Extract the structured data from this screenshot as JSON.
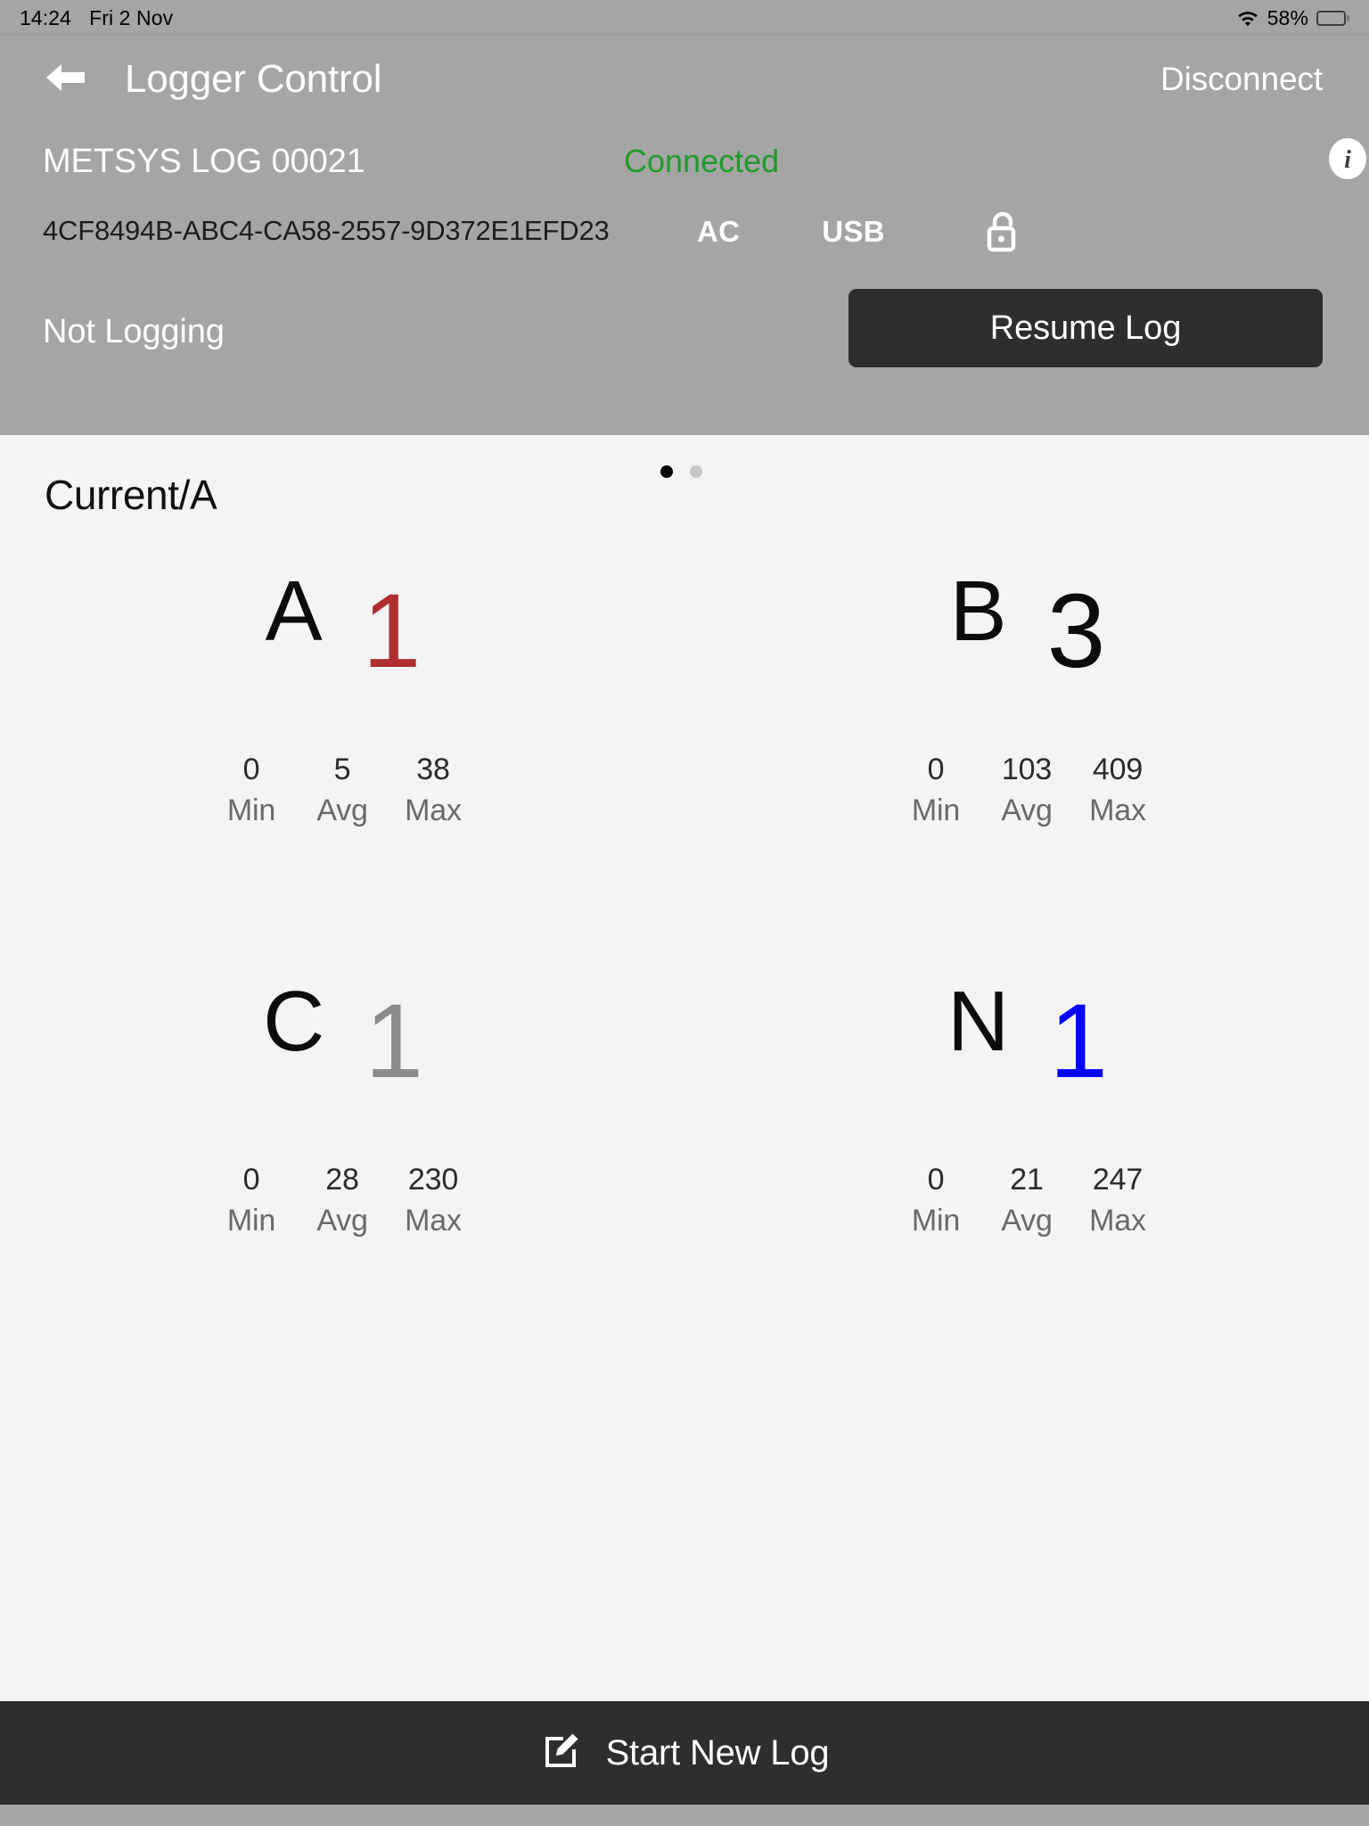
{
  "status_bar": {
    "time": "14:24",
    "date": "Fri 2 Nov",
    "battery_percent": "58%",
    "wifi_icon": "wifi-icon",
    "battery_icon": "battery-icon"
  },
  "nav": {
    "back_icon": "back-arrow-icon",
    "title": "Logger Control",
    "disconnect_label": "Disconnect"
  },
  "device": {
    "log_name": "METSYS LOG 00021",
    "uuid": "4CF8494B-ABC4-CA58-2557-9D372E1EFD23",
    "connection_status": "Connected",
    "connection_status_color": "#1f9b28",
    "info_icon": "info-icon",
    "power_ac": "AC",
    "power_usb": "USB",
    "lock_icon": "unlocked-padlock-icon",
    "logging_state": "Not Logging",
    "resume_label": "Resume Log"
  },
  "main": {
    "section_title": "Current/A",
    "page_dots": [
      {
        "active": true
      },
      {
        "active": false
      }
    ],
    "stat_labels": {
      "min": "Min",
      "avg": "Avg",
      "max": "Max"
    },
    "phases": [
      {
        "label": "A",
        "value": "1",
        "color": "#b22f2f",
        "min": "0",
        "avg": "5",
        "max": "38"
      },
      {
        "label": "B",
        "value": "3",
        "color": "#0c0c0c",
        "min": "0",
        "avg": "103",
        "max": "409"
      },
      {
        "label": "C",
        "value": "1",
        "color": "#8c8c8c",
        "min": "0",
        "avg": "28",
        "max": "230"
      },
      {
        "label": "N",
        "value": "1",
        "color": "#0000ff",
        "min": "0",
        "avg": "21",
        "max": "247"
      }
    ]
  },
  "bottom": {
    "compose_icon": "compose-pencil-icon",
    "label": "Start New Log"
  },
  "colors": {
    "panel_gray": "#a5a5a5",
    "page_background": "#f4f4f4",
    "button_dark": "#2e2e2e"
  }
}
